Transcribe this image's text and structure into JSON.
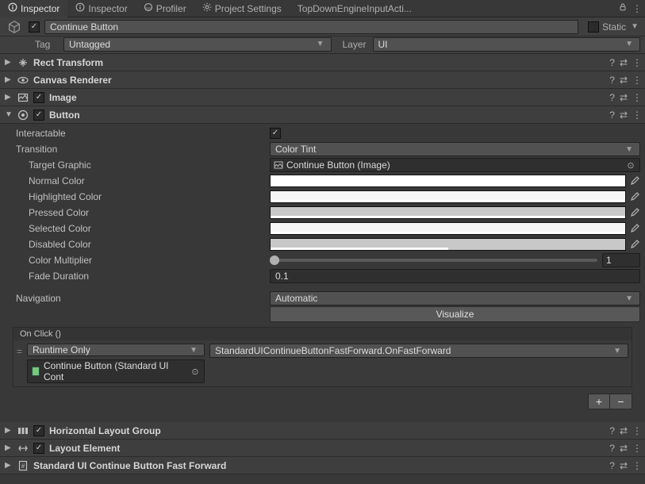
{
  "tabs": {
    "items": [
      "Inspector",
      "Inspector",
      "Profiler",
      "Project Settings",
      "TopDownEngineInputActi..."
    ],
    "active_index": 0
  },
  "header": {
    "enabled": true,
    "name": "Continue Button",
    "static_label": "Static",
    "static_checked": false
  },
  "tagrow": {
    "tag_label": "Tag",
    "tag_value": "Untagged",
    "layer_label": "Layer",
    "layer_value": "UI"
  },
  "components": {
    "rect_transform": {
      "title": "Rect Transform",
      "expanded": false
    },
    "canvas_renderer": {
      "title": "Canvas Renderer",
      "expanded": false
    },
    "image": {
      "title": "Image",
      "expanded": false,
      "enabled": true
    },
    "button": {
      "title": "Button",
      "expanded": true,
      "enabled": true
    },
    "h_layout": {
      "title": "Horizontal Layout Group",
      "expanded": false,
      "enabled": true
    },
    "layout_elem": {
      "title": "Layout Element",
      "expanded": false,
      "enabled": true
    },
    "ui_continue": {
      "title": "Standard UI Continue Button Fast Forward",
      "expanded": false
    }
  },
  "button": {
    "labels": {
      "interactable": "Interactable",
      "transition": "Transition",
      "target_graphic": "Target Graphic",
      "normal_color": "Normal Color",
      "highlighted_color": "Highlighted Color",
      "pressed_color": "Pressed Color",
      "selected_color": "Selected Color",
      "disabled_color": "Disabled Color",
      "color_multiplier": "Color Multiplier",
      "fade_duration": "Fade Duration",
      "navigation": "Navigation",
      "visualize": "Visualize"
    },
    "values": {
      "interactable": true,
      "transition": "Color Tint",
      "target_graphic": "Continue Button (Image)",
      "colors": {
        "normal": {
          "hex": "#ffffff",
          "alpha": 1.0
        },
        "highlighted": {
          "hex": "#f5f5f5",
          "alpha": 1.0
        },
        "pressed": {
          "hex": "#c8c8c8",
          "alpha": 1.0
        },
        "selected": {
          "hex": "#f5f5f5",
          "alpha": 1.0
        },
        "disabled": {
          "hex": "#c8c8c8",
          "alpha": 0.5
        }
      },
      "color_multiplier": "1",
      "fade_duration": "0.1",
      "navigation": "Automatic"
    }
  },
  "event": {
    "title": "On Click ()",
    "runtime": "Runtime Only",
    "func": "StandardUIContinueButtonFastForward.OnFastForward",
    "target": "Continue Button (Standard UI Cont"
  }
}
